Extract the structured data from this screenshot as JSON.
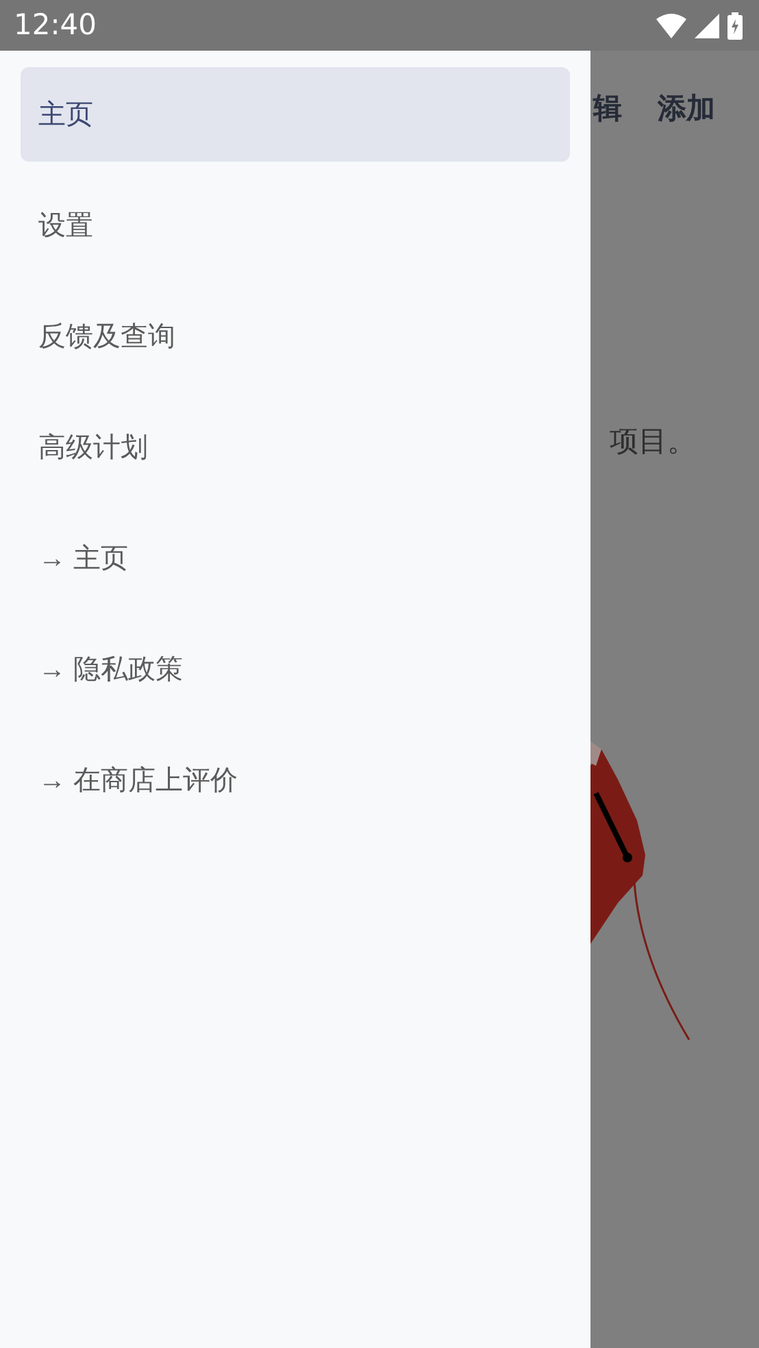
{
  "status_bar": {
    "time": "12:40"
  },
  "drawer": {
    "items": [
      {
        "label": "主页",
        "selected": true
      },
      {
        "label": "设置",
        "selected": false
      },
      {
        "label": "反馈及查询",
        "selected": false
      },
      {
        "label": "高级计划",
        "selected": false
      },
      {
        "label": "→ 主页",
        "selected": false
      },
      {
        "label": "→ 隐私政策",
        "selected": false
      },
      {
        "label": "→ 在商店上评价",
        "selected": false
      }
    ]
  },
  "background_page": {
    "toolbar_actions": [
      "辑",
      "添加"
    ],
    "text": "项目。"
  }
}
